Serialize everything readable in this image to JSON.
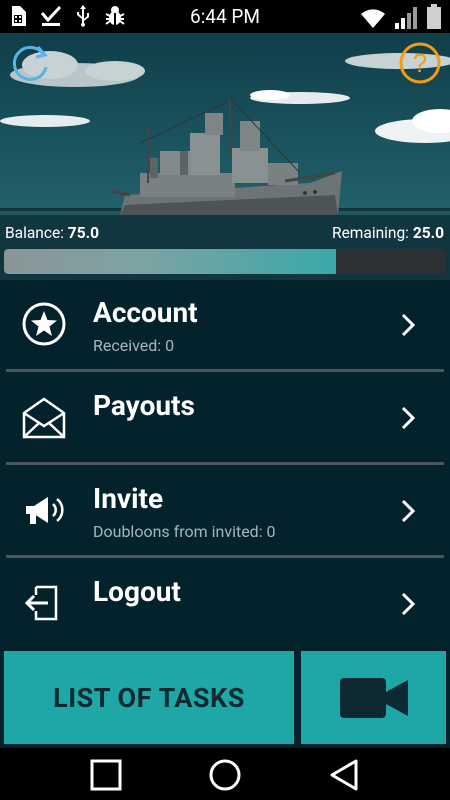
{
  "status_bar": {
    "time": "6:44 PM",
    "icons": [
      "sim-icon",
      "download-done-icon",
      "usb-icon",
      "bug-icon",
      "wifi-icon",
      "signal-icon",
      "battery-icon"
    ]
  },
  "hero": {
    "balance_label": "Balance:",
    "balance_value": "75.0",
    "remaining_label": "Remaining:",
    "remaining_value": "25.0",
    "progress_percent": 75,
    "icons": [
      "refresh-icon",
      "help-icon"
    ],
    "accent_color": "#f39c12"
  },
  "menu": {
    "items": [
      {
        "title": "Account",
        "subtitle": "Received: 0",
        "icon": "star-icon"
      },
      {
        "title": "Payouts",
        "subtitle": "",
        "icon": "envelope-icon"
      },
      {
        "title": "Invite",
        "subtitle": "Doubloons from invited: 0",
        "icon": "megaphone-icon"
      },
      {
        "title": "Logout",
        "subtitle": "",
        "icon": "logout-icon"
      }
    ]
  },
  "bottom": {
    "tasks_label": "LIST OF TASKS",
    "video_icon": "video-camera-icon",
    "button_color": "#1fa7a7"
  },
  "nav": {
    "icons": [
      "recents-icon",
      "home-icon",
      "back-icon"
    ]
  }
}
